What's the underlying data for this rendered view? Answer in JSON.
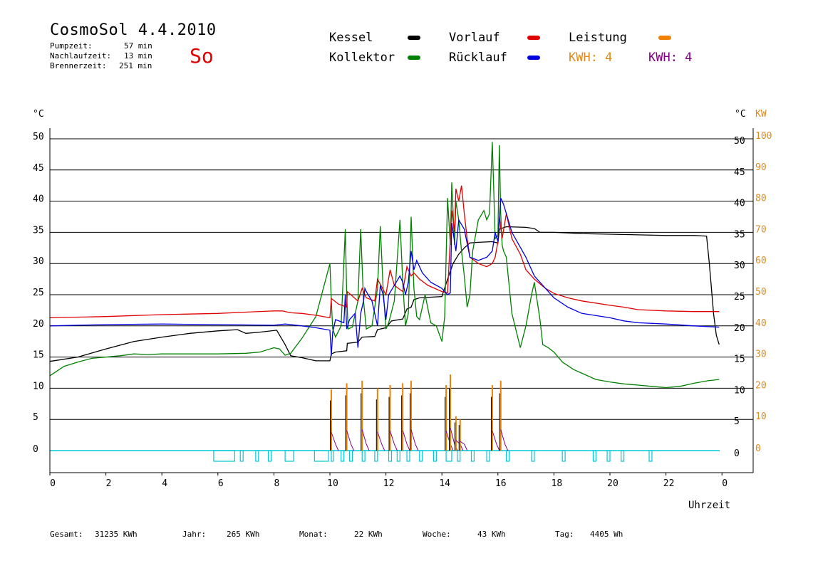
{
  "header": {
    "title": "CosmoSol 4.4.2010",
    "stats": [
      {
        "label": "Pumpzeit:",
        "value": "57 min"
      },
      {
        "label": "Nachlaufzeit:",
        "value": "13 min"
      },
      {
        "label": "Brennerzeit:",
        "value": "251 min"
      }
    ],
    "day": "So"
  },
  "legend": [
    {
      "label": "Kessel",
      "color": "#000000"
    },
    {
      "label": "Kollektor",
      "color": "#008000"
    },
    {
      "label": "Vorlauf",
      "color": "#e00000"
    },
    {
      "label": "Rücklauf",
      "color": "#0000e0"
    },
    {
      "label": "Leistung",
      "color": "#f08000"
    }
  ],
  "kwh": [
    {
      "label": "KWH: 4",
      "color": "#e08a1e"
    },
    {
      "label": "KWH: 4",
      "color": "#800080"
    }
  ],
  "footer": [
    {
      "label": "Gesamt:",
      "value": "31235 KWh"
    },
    {
      "label": "Jahr:",
      "value": "265 KWh"
    },
    {
      "label": "Monat:",
      "value": "22 KWh"
    },
    {
      "label": "Woche:",
      "value": "43 KWh"
    },
    {
      "label": "Tag:",
      "value": "4405 Wh"
    }
  ],
  "chart_data": {
    "type": "line",
    "xlabel": "Uhrzeit",
    "ylabel_left": "°C",
    "ylabel_right": "°C",
    "ylabel_right2": "KW",
    "xlim": [
      0,
      24
    ],
    "ylim": [
      -3.5,
      50
    ],
    "ylim_right2": [
      0,
      100
    ],
    "x_ticks": [
      "0",
      "2",
      "4",
      "6",
      "8",
      "10",
      "12",
      "14",
      "16",
      "18",
      "20",
      "22",
      "0"
    ],
    "y_ticks_left": [
      "50",
      "45",
      "40",
      "35",
      "30",
      "25",
      "20",
      "15",
      "10",
      "5",
      "0"
    ],
    "y_ticks_right": [
      "50",
      "45",
      "40",
      "35",
      "30",
      "25",
      "20",
      "15",
      "10",
      "5",
      "0"
    ],
    "y_ticks_right2": [
      "100",
      "90",
      "80",
      "70",
      "60",
      "50",
      "40",
      "30",
      "20",
      "10",
      "0"
    ],
    "grid": "horizontal",
    "series": [
      {
        "name": "Kessel",
        "color": "#000000",
        "x": [
          0,
          1,
          2,
          3,
          4,
          5,
          6,
          6.7,
          7,
          7.5,
          8.1,
          8.4,
          8.6,
          9,
          9.5,
          10,
          10.05,
          10.2,
          10.6,
          10.62,
          11,
          11.15,
          11.6,
          11.7,
          12,
          12.2,
          12.6,
          12.75,
          12.9,
          13,
          13.2,
          14,
          14.2,
          14.4,
          14.6,
          14.8,
          15,
          15.3,
          15.8,
          16,
          16.05,
          16.3,
          17,
          17.3,
          17.5,
          18,
          19,
          20,
          21,
          22,
          23,
          23.45,
          23.55,
          23.7,
          23.8,
          23.9
        ],
        "y": [
          14.3,
          15,
          16.3,
          17.5,
          18.2,
          18.8,
          19.2,
          19.4,
          18.8,
          19,
          19.3,
          17,
          15.2,
          14.9,
          14.4,
          14.4,
          15.5,
          15.8,
          16,
          17.2,
          17.4,
          18.2,
          18.3,
          19.4,
          19.7,
          20.8,
          21.1,
          22.7,
          23,
          24.2,
          24.5,
          24.7,
          27.5,
          30,
          31.5,
          32.5,
          33.3,
          33.4,
          33.5,
          33.3,
          35.5,
          35.9,
          35.8,
          35.6,
          35,
          35,
          34.8,
          34.7,
          34.6,
          34.5,
          34.5,
          34.4,
          30,
          22,
          18.5,
          17
        ]
      },
      {
        "name": "Kollektor",
        "color": "#008000",
        "x": [
          0,
          0.5,
          1,
          1.5,
          2,
          2.5,
          3,
          3.5,
          4,
          5,
          6,
          7,
          7.5,
          8,
          8.2,
          8.4,
          8.6,
          9,
          9.5,
          10,
          10.05,
          10.1,
          10.2,
          10.4,
          10.55,
          10.6,
          10.65,
          10.8,
          11,
          11.1,
          11.2,
          11.3,
          11.5,
          11.7,
          11.8,
          11.9,
          12,
          12.1,
          12.3,
          12.5,
          12.6,
          12.7,
          12.8,
          12.9,
          13,
          13.1,
          13.2,
          13.4,
          13.6,
          13.8,
          14,
          14.1,
          14.2,
          14.3,
          14.35,
          14.45,
          14.5,
          14.6,
          14.7,
          14.8,
          14.9,
          15,
          15.1,
          15.3,
          15.5,
          15.6,
          15.7,
          15.8,
          15.85,
          15.9,
          16,
          16.05,
          16.1,
          16.15,
          16.2,
          16.3,
          16.5,
          16.8,
          17,
          17.2,
          17.3,
          17.5,
          17.6,
          17.8,
          18,
          18.3,
          18.7,
          19,
          19.5,
          20,
          20.5,
          21,
          21.5,
          22,
          22.5,
          23,
          23.5,
          23.9
        ],
        "y": [
          12,
          13.5,
          14.2,
          14.8,
          15,
          15.2,
          15.5,
          15.4,
          15.5,
          15.5,
          15.5,
          15.6,
          15.8,
          16.5,
          16.3,
          15.3,
          15.6,
          18,
          21.5,
          30,
          24,
          19.5,
          18.2,
          20,
          35.5,
          25,
          19.5,
          19.8,
          24,
          35.5,
          24,
          19.5,
          20,
          26,
          36,
          26,
          19.5,
          20.5,
          24,
          37,
          27,
          20,
          22,
          37.5,
          26,
          21.5,
          21,
          25,
          20.5,
          20,
          17.5,
          21.5,
          40.5,
          33,
          43,
          33,
          40,
          37,
          32,
          28,
          23,
          25,
          32,
          37,
          38.5,
          37,
          38,
          49.5,
          42,
          34,
          34.5,
          49,
          38,
          33,
          32,
          31,
          22,
          16.5,
          20,
          25,
          27,
          21,
          17,
          16.5,
          15.8,
          14.2,
          13,
          12.4,
          11.4,
          11,
          10.7,
          10.5,
          10.3,
          10.1,
          10.3,
          10.8,
          11.2,
          11.4
        ]
      },
      {
        "name": "Vorlauf",
        "color": "#e00000",
        "x": [
          0,
          2,
          4,
          6,
          7,
          8,
          8.3,
          8.6,
          9,
          9.5,
          10,
          10.05,
          10.3,
          10.6,
          10.62,
          11,
          11.15,
          11.3,
          11.6,
          11.7,
          12,
          12.15,
          12.3,
          12.6,
          12.75,
          12.9,
          13,
          13.2,
          13.5,
          14,
          14.2,
          14.35,
          14.45,
          14.5,
          14.6,
          14.7,
          14.8,
          14.9,
          15,
          15.3,
          15.6,
          15.8,
          15.9,
          16,
          16.05,
          16.15,
          16.3,
          16.5,
          16.8,
          17,
          17.3,
          17.7,
          18,
          18.5,
          19,
          20,
          20.5,
          21,
          22,
          23,
          23.9
        ],
        "y": [
          21.3,
          21.5,
          21.8,
          22,
          22.2,
          22.4,
          22.4,
          22.1,
          22,
          21.7,
          21.3,
          24.4,
          23.5,
          23,
          25.5,
          24,
          26,
          24.5,
          24,
          27.5,
          25,
          29,
          26.5,
          25.5,
          29.5,
          28,
          28.5,
          27.5,
          26.5,
          25.5,
          25.3,
          38.5,
          35,
          42,
          40,
          42.5,
          38,
          34,
          31,
          30,
          29.5,
          30,
          31,
          33.5,
          37.5,
          34,
          38,
          34,
          31.5,
          29,
          27.5,
          26,
          25.2,
          24.5,
          24,
          23.3,
          23,
          22.6,
          22.4,
          22.3,
          22.3
        ]
      },
      {
        "name": "Rücklauf",
        "color": "#0000e0",
        "x": [
          0,
          1,
          2,
          4,
          6,
          8,
          8.4,
          9,
          9.5,
          10,
          10.05,
          10.1,
          10.2,
          10.5,
          10.55,
          10.6,
          10.7,
          10.9,
          11,
          11.1,
          11.2,
          11.25,
          11.3,
          11.5,
          11.7,
          11.8,
          11.9,
          12,
          12.1,
          12.3,
          12.5,
          12.6,
          12.7,
          12.8,
          12.9,
          13,
          13.1,
          13.3,
          13.6,
          14,
          14.1,
          14.2,
          14.3,
          14.35,
          14.5,
          14.6,
          14.8,
          15,
          15.3,
          15.6,
          15.8,
          15.9,
          16,
          16.1,
          16.2,
          16.3,
          16.5,
          17,
          17.3,
          17.7,
          18,
          18.5,
          19,
          20,
          20.5,
          21,
          22,
          23,
          23.9
        ],
        "y": [
          20,
          20.1,
          20.2,
          20.3,
          20.2,
          20.1,
          20.3,
          20,
          19.7,
          19.3,
          15.2,
          19,
          21,
          20.5,
          25,
          19.5,
          21,
          22,
          16.5,
          22,
          24,
          26,
          25.5,
          24,
          20,
          26.5,
          25,
          21,
          25,
          26.5,
          28,
          27,
          25,
          27,
          32,
          29,
          30.5,
          28.5,
          27,
          26,
          25.5,
          25,
          25.3,
          36.5,
          32,
          37,
          35.5,
          31,
          30.5,
          31,
          32,
          35,
          33.5,
          40.5,
          39.5,
          38,
          35,
          31,
          28,
          26,
          24.5,
          23,
          22,
          21.3,
          20.8,
          20.5,
          20.3,
          20,
          19.8
        ]
      }
    ],
    "power_bars": {
      "name": "Leistung",
      "color": "#f08000",
      "max_color": "#000000",
      "x": [
        10.05,
        10.6,
        11.15,
        11.7,
        12.15,
        12.6,
        12.9,
        14.15,
        14.3,
        14.5,
        14.65,
        15.8,
        16.1
      ],
      "y": [
        9.8,
        10.8,
        11.2,
        10,
        10.5,
        10.8,
        11.2,
        10.5,
        12.2,
        5.5,
        5,
        10.5,
        11.2
      ]
    },
    "pump_blocks": {
      "color": "#00c8d8",
      "x_ranges": [
        [
          5.85,
          6.6
        ],
        [
          6.8,
          6.9
        ],
        [
          7.35,
          7.45
        ],
        [
          7.8,
          7.9
        ],
        [
          8.4,
          8.7
        ],
        [
          9.45,
          9.95
        ],
        [
          10.05,
          10.12
        ],
        [
          10.4,
          10.5
        ],
        [
          10.7,
          10.8
        ],
        [
          11.15,
          11.25
        ],
        [
          11.6,
          11.7
        ],
        [
          12.1,
          12.2
        ],
        [
          12.4,
          12.5
        ],
        [
          12.75,
          12.85
        ],
        [
          13.2,
          13.3
        ],
        [
          13.7,
          13.8
        ],
        [
          14.15,
          14.35
        ],
        [
          14.55,
          14.65
        ],
        [
          15.05,
          15.15
        ],
        [
          15.6,
          15.7
        ],
        [
          16.3,
          16.4
        ],
        [
          17.2,
          17.3
        ],
        [
          18.3,
          18.4
        ],
        [
          19.4,
          19.5
        ],
        [
          19.9,
          20.0
        ],
        [
          20.4,
          20.5
        ],
        [
          21.4,
          21.5
        ]
      ]
    }
  }
}
